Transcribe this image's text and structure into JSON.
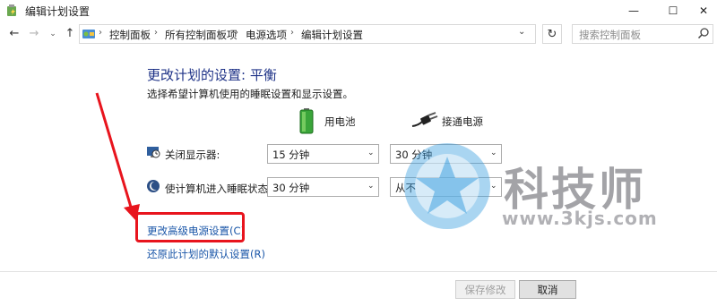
{
  "window": {
    "title": "编辑计划设置",
    "controls": {
      "minimize": "—",
      "maximize": "☐",
      "close": "✕"
    }
  },
  "nav": {
    "back": "←",
    "forward": "→",
    "recent": "⌄",
    "up": "↑",
    "breadcrumb": [
      "控制面板",
      "所有控制面板项",
      "电源选项",
      "编辑计划设置"
    ],
    "separator": "›",
    "dropdown": "⌄",
    "refresh": "↻",
    "search_placeholder": "搜索控制面板"
  },
  "main": {
    "heading": "更改计划的设置: 平衡",
    "subheading": "选择希望计算机使用的睡眠设置和显示设置。",
    "columns": {
      "battery": "用电池",
      "plugged_in": "接通电源"
    },
    "rows": [
      {
        "label": "关闭显示器:",
        "battery_value": "15 分钟",
        "plugged_value": "30 分钟"
      },
      {
        "label": "使计算机进入睡眠状态:",
        "battery_value": "30 分钟",
        "plugged_value": "从不"
      }
    ],
    "dropdown_arrow": "⌄",
    "links": {
      "advanced": "更改高级电源设置(C)",
      "restore": "还原此计划的默认设置(R)"
    }
  },
  "footer": {
    "save": "保存修改",
    "cancel": "取消"
  },
  "watermark": {
    "brand": "科技师",
    "url": "www.3kjs.com"
  },
  "colors": {
    "heading": "#1e3287",
    "link": "#1a56a8",
    "highlight": "#e8141d",
    "watermark_blue": "#3a9fe0"
  },
  "icons": {
    "app": "power-options-icon",
    "control_panel": "control-panel-icon",
    "search": "search-icon",
    "battery": "battery-icon",
    "plug": "power-plug-icon",
    "display": "monitor-clock-icon",
    "sleep": "moon-sleep-icon"
  }
}
